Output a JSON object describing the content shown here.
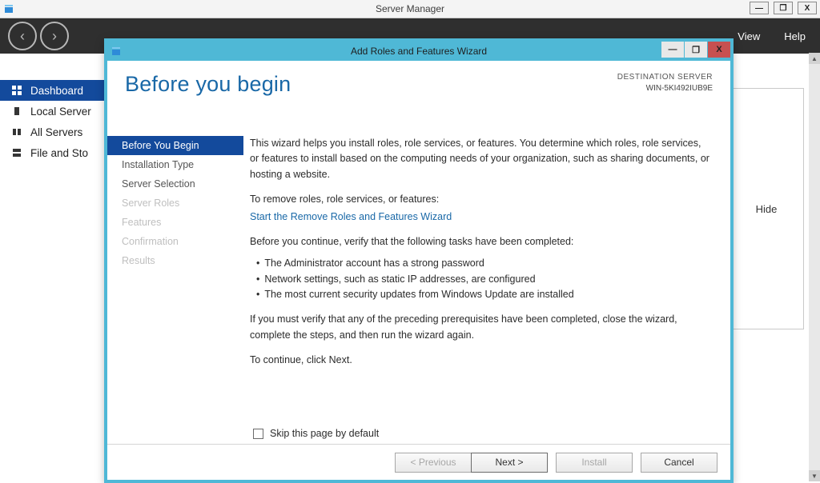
{
  "server_manager": {
    "title": "Server Manager",
    "window_controls": {
      "min": "—",
      "max": "❐",
      "close": "X"
    },
    "toolbar": {
      "nav_back": "‹",
      "nav_forward": "›",
      "menu": {
        "view": "View",
        "help": "Help"
      }
    },
    "nav": {
      "items": [
        {
          "label": "Dashboard",
          "icon": "dashboard-icon",
          "selected": true
        },
        {
          "label": "Local Server",
          "icon": "server-icon",
          "selected": false
        },
        {
          "label": "All Servers",
          "icon": "servers-icon",
          "selected": false
        },
        {
          "label": "File and Sto",
          "icon": "storage-icon",
          "selected": false
        }
      ]
    },
    "hide_label": "Hide"
  },
  "wizard": {
    "window_title": "Add Roles and Features Wizard",
    "window_controls": {
      "min": "—",
      "max": "❐",
      "close": "X"
    },
    "heading": "Before you begin",
    "destination": {
      "label": "DESTINATION SERVER",
      "server": "WIN-5KI492IUB9E"
    },
    "steps": [
      {
        "label": "Before You Begin",
        "state": "active"
      },
      {
        "label": "Installation Type",
        "state": "enabled"
      },
      {
        "label": "Server Selection",
        "state": "enabled"
      },
      {
        "label": "Server Roles",
        "state": "disabled"
      },
      {
        "label": "Features",
        "state": "disabled"
      },
      {
        "label": "Confirmation",
        "state": "disabled"
      },
      {
        "label": "Results",
        "state": "disabled"
      }
    ],
    "content": {
      "intro": "This wizard helps you install roles, role services, or features. You determine which roles, role services, or features to install based on the computing needs of your organization, such as sharing documents, or hosting a website.",
      "remove_title": "To remove roles, role services, or features:",
      "remove_link": "Start the Remove Roles and Features Wizard",
      "verify_title": "Before you continue, verify that the following tasks have been completed:",
      "bullets": [
        "The Administrator account has a strong password",
        "Network settings, such as static IP addresses, are configured",
        "The most current security updates from Windows Update are installed"
      ],
      "must_verify": "If you must verify that any of the preceding prerequisites have been completed, close the wizard, complete the steps, and then run the wizard again.",
      "continue_hint": "To continue, click Next."
    },
    "skip_label": "Skip this page by default",
    "buttons": {
      "previous": "< Previous",
      "next": "Next >",
      "install": "Install",
      "cancel": "Cancel"
    }
  }
}
